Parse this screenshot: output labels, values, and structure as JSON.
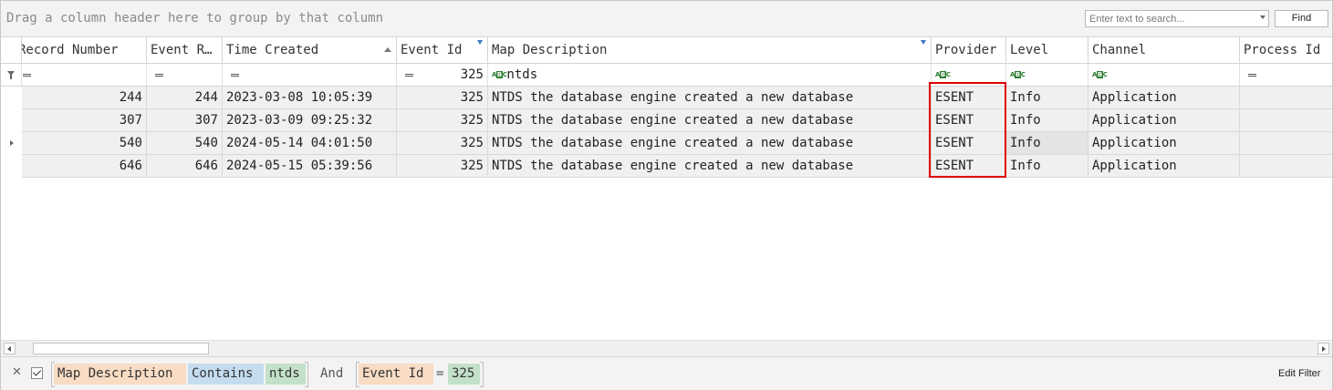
{
  "group_panel": {
    "hint": "Drag a column header here to group by that column",
    "search_placeholder": "Enter text to search...",
    "find_label": "Find"
  },
  "columns": [
    {
      "key": "record_number",
      "label": "Record Number"
    },
    {
      "key": "event_record",
      "label": "Event R…"
    },
    {
      "key": "time_created",
      "label": "Time Created",
      "sorted": "ascending"
    },
    {
      "key": "event_id",
      "label": "Event Id",
      "filtered": true
    },
    {
      "key": "map_description",
      "label": "Map Description",
      "filtered": true
    },
    {
      "key": "provider",
      "label": "Provider"
    },
    {
      "key": "level",
      "label": "Level"
    },
    {
      "key": "channel",
      "label": "Channel"
    },
    {
      "key": "process_id",
      "label": "Process Id"
    }
  ],
  "filter_row": {
    "event_id_value": "325",
    "map_description_value": "ntds"
  },
  "rows": [
    {
      "record_number": "244",
      "event_record": "244",
      "time_created": "2023-03-08 10:05:39",
      "event_id": "325",
      "map_description": "NTDS the database engine created a new database",
      "provider": "ESENT",
      "level": "Info",
      "channel": "Application",
      "process_id": ""
    },
    {
      "record_number": "307",
      "event_record": "307",
      "time_created": "2023-03-09 09:25:32",
      "event_id": "325",
      "map_description": "NTDS the database engine created a new database",
      "provider": "ESENT",
      "level": "Info",
      "channel": "Application",
      "process_id": ""
    },
    {
      "record_number": "540",
      "event_record": "540",
      "time_created": "2024-05-14 04:01:50",
      "event_id": "325",
      "map_description": "NTDS the database engine created a new database",
      "provider": "ESENT",
      "level": "Info",
      "channel": "Application",
      "process_id": "",
      "current": true
    },
    {
      "record_number": "646",
      "event_record": "646",
      "time_created": "2024-05-15 05:39:56",
      "event_id": "325",
      "map_description": "NTDS the database engine created a new database",
      "provider": "ESENT",
      "level": "Info",
      "channel": "Application",
      "process_id": ""
    }
  ],
  "filter_bar": {
    "close_glyph": "✕",
    "cond1_field": "Map Description",
    "cond1_op": "Contains",
    "cond1_value": "ntds",
    "joiner": "And",
    "cond2_field": "Event Id",
    "cond2_op": "=",
    "cond2_value": "325",
    "edit_label": "Edit Filter"
  },
  "icons": {
    "filter_row": "funnel-icon",
    "text_filter": "abc-text-filter-icon",
    "equals": "equals-icon",
    "sort": "sort-ascending-icon",
    "column_filter": "column-filter-icon",
    "current_row": "row-indicator-arrow-icon"
  },
  "colors": {
    "highlight_box": "#e00000",
    "field_token": "#f8dcc4",
    "operator_token": "#c5dcef",
    "value_token": "#c3e1c9"
  }
}
